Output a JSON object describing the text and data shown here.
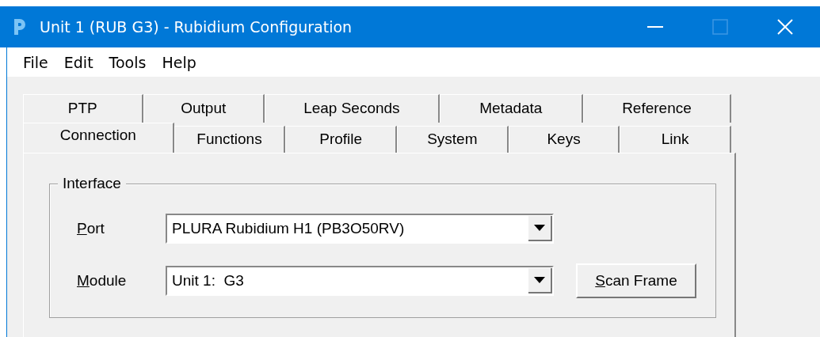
{
  "window": {
    "title": "Unit 1 (RUB G3) - Rubidium Configuration"
  },
  "menu": [
    "File",
    "Edit",
    "Tools",
    "Help"
  ],
  "tab_rows": [
    [
      {
        "label": "PTP",
        "selected": false
      },
      {
        "label": "Output",
        "selected": false
      },
      {
        "label": "Leap Seconds",
        "selected": false
      },
      {
        "label": "Metadata",
        "selected": false
      },
      {
        "label": "Reference",
        "selected": false
      }
    ],
    [
      {
        "label": "Connection",
        "selected": true
      },
      {
        "label": "Functions",
        "selected": false
      },
      {
        "label": "Profile",
        "selected": false
      },
      {
        "label": "System",
        "selected": false
      },
      {
        "label": "Keys",
        "selected": false
      },
      {
        "label": "Link",
        "selected": false
      }
    ]
  ],
  "group": {
    "title": "Interface",
    "fields": [
      {
        "label": "Port",
        "value": "PLURA Rubidium H1 (PB3O50RV)"
      },
      {
        "label": "Module",
        "value": "Unit 1:  G3"
      }
    ],
    "button": {
      "label": "Scan Frame"
    }
  }
}
